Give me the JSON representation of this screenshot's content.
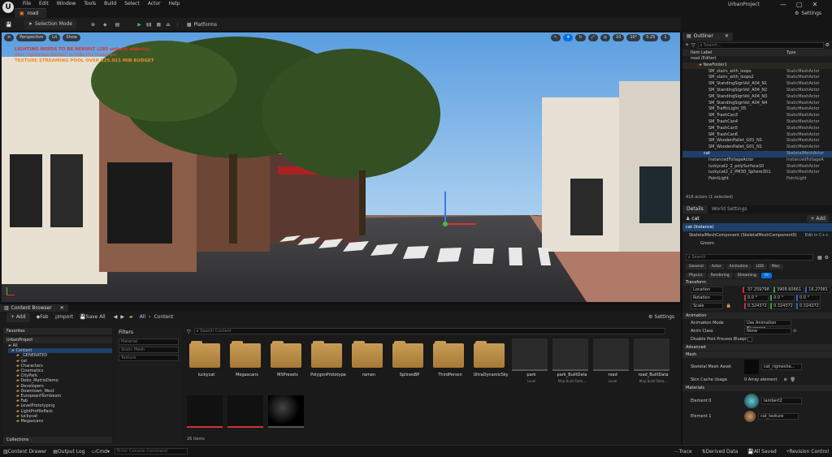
{
  "app": {
    "project": "UrbanProject",
    "level_tab": "road"
  },
  "menu": [
    "File",
    "Edit",
    "Window",
    "Tools",
    "Build",
    "Select",
    "Actor",
    "Help"
  ],
  "toolbar": {
    "selection_mode": "Selection Mode",
    "platforms": "Platforms",
    "settings": "Settings"
  },
  "viewport": {
    "perspective": "Perspective",
    "lit": "Lit",
    "show": "Show",
    "warnings": [
      "LIGHTING NEEDS TO BE REBUILT (285 unbuilt objects)",
      "(Run 'lightmass.hidden' to hide this message)",
      "TEXTURE STREAMING POOL OVER 925.021 MiB BUDGET"
    ],
    "grid": "10",
    "rot": "10°",
    "scale": "0.25",
    "cam": "1"
  },
  "outliner": {
    "tab": "Outliner",
    "search_placeholder": "Search...",
    "col_label": "Item Label",
    "col_type": "Type",
    "root": "road (Editor)",
    "folder": "NewFolder1",
    "items": [
      {
        "name": "SM_stairs_with_loops",
        "type": "StaticMeshActor"
      },
      {
        "name": "SM_stairs_with_loops2",
        "type": "StaticMeshActor"
      },
      {
        "name": "SM_StandingSignVol_A04_N1",
        "type": "StaticMeshActor"
      },
      {
        "name": "SM_StandingSignVol_A04_N2",
        "type": "StaticMeshActor"
      },
      {
        "name": "SM_StandingSignVol_A04_N3",
        "type": "StaticMeshActor"
      },
      {
        "name": "SM_StandingSignVol_A04_N4",
        "type": "StaticMeshActor"
      },
      {
        "name": "SM_TrafficLight_05",
        "type": "StaticMeshActor"
      },
      {
        "name": "SM_TrashCan3",
        "type": "StaticMeshActor"
      },
      {
        "name": "SM_TrashCan4",
        "type": "StaticMeshActor"
      },
      {
        "name": "SM_TrashCan5",
        "type": "StaticMeshActor"
      },
      {
        "name": "SM_TrashCan6",
        "type": "StaticMeshActor"
      },
      {
        "name": "SM_WoodenPallet_G01_N1",
        "type": "StaticMeshActor"
      },
      {
        "name": "SM_WoodenPallet_G01_N1",
        "type": "StaticMeshActor"
      },
      {
        "name": "cat",
        "type": "SkeletalMeshActor"
      },
      {
        "name": "InstancedFoliageActor",
        "type": "InstancedFoliageA"
      },
      {
        "name": "luckycat2_2_polySurface10",
        "type": "StaticMeshActor"
      },
      {
        "name": "luckycat2_2_PM3D_Sphere3D1",
        "type": "StaticMeshActor"
      },
      {
        "name": "PointLight",
        "type": "PointLight"
      }
    ],
    "count": "418 actors (1 selected)"
  },
  "details": {
    "tab": "Details",
    "tab2": "World Settings",
    "actor": "cat",
    "add": "+ Add",
    "instance": "cat (Instance)",
    "component": "SkeletalMeshComponent (SkeletalMeshComponent0)",
    "edit": "Edit in C++",
    "groom": "Groom",
    "search_placeholder": "Search",
    "filters": [
      "General",
      "Actor",
      "Animation",
      "LOD",
      "Misc",
      "Physics",
      "Rendering",
      "Streaming",
      "All"
    ],
    "transform": "Transform",
    "location": {
      "label": "Location",
      "x": "-37.259798",
      "y": "3908.60661",
      "z": "16.27081"
    },
    "rotation": {
      "label": "Rotation",
      "x": "0.0 °",
      "y": "0.0 °",
      "z": "0.0 °"
    },
    "scale": {
      "label": "Scale",
      "x": "0.324372",
      "y": "0.324372",
      "z": "0.324372"
    },
    "animation": "Animation",
    "anim_mode": {
      "label": "Animation Mode",
      "value": "Use Animation Blueprint"
    },
    "anim_class": {
      "label": "Anim Class",
      "value": "None"
    },
    "disable_pp": "Disable Post Process Bluepr...",
    "advanced": "Advanced",
    "mesh": "Mesh",
    "skel_mesh": {
      "label": "Skeletal Mesh Asset",
      "value": "cat_rigmeshe..."
    },
    "skin_cache": {
      "label": "Skin Cache Usage",
      "value": "0 Array element"
    },
    "materials": "Materials",
    "element0": {
      "label": "Element 0",
      "value": "lambert2"
    },
    "element1": {
      "label": "Element 1",
      "value": "cat_texture"
    }
  },
  "content_browser": {
    "tab": "Content Browser",
    "add": "+ Add",
    "import": "Import",
    "save_all": "Save All",
    "fab": "Fab",
    "path": [
      "All",
      "Content"
    ],
    "settings": "Settings",
    "favorites": "Favorites",
    "project": "UrbanProject",
    "tree": [
      "All",
      "Content",
      "_GENERATED",
      "cat",
      "Characters",
      "Cinematics",
      "CityPark",
      "Debo_MatrixDemo",
      "Developers",
      "Downtown_West",
      "EuropeanHornbeam",
      "Fab",
      "LevelPrototyping",
      "LightProfilePack",
      "luckycat",
      "Megascans"
    ],
    "collections": "Collections",
    "filters": "Filters",
    "filter_items": [
      "Material",
      "Static Mesh",
      "Texture"
    ],
    "search_placeholder": "Search Content",
    "assets": [
      "luckycat",
      "Megascans",
      "MSPresets",
      "PolygonPrototype",
      "ramen",
      "SplinesBP",
      "ThirdPerson",
      "UltraDynamicSky",
      "park",
      "park_BuiltData",
      "road",
      "road_BuiltData",
      "",
      "",
      ""
    ],
    "asset_sub": [
      "",
      "",
      "",
      "",
      "",
      "",
      "",
      "",
      "Level",
      "Map Build Data...",
      "Level",
      "Map Build Data...",
      "",
      "",
      ""
    ],
    "count": "26 items"
  },
  "status": {
    "drawer": "Content Drawer",
    "output": "Output Log",
    "cmd": "Cmd",
    "console_placeholder": "Enter Console Command",
    "trace": "Trace",
    "derived": "Derived Data",
    "saved": "All Saved",
    "revision": "Revision Control"
  },
  "colors": {
    "accent": "#0070e0",
    "selected": "#1f3f6a",
    "folder": "#c89b55",
    "warn_red": "#e83030",
    "warn_orange": "#f08a2a"
  }
}
